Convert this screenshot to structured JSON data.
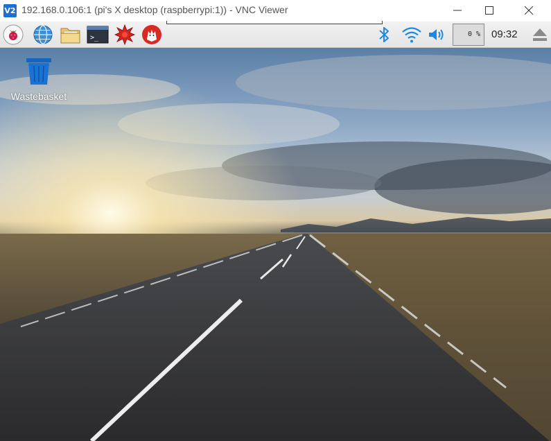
{
  "window": {
    "app_icon_text": "V2",
    "title": "192.168.0.106:1 (pi's X desktop (raspberrypi:1)) - VNC Viewer"
  },
  "panel": {
    "launchers": [
      "raspberry-menu-icon",
      "web-browser-icon",
      "file-manager-icon",
      "terminal-icon",
      "math-icon",
      "wolfram-icon"
    ],
    "tray": [
      "bluetooth-icon",
      "wifi-icon",
      "volume-icon"
    ],
    "cpu_usage": "0 %",
    "clock": "09:32",
    "eject_icon": "eject-icon"
  },
  "desktop": {
    "icons": [
      {
        "label": "Wastebasket",
        "icon": "trash-icon"
      }
    ]
  },
  "colors": {
    "accent": "#1f6fd1",
    "trash_blue": "#1a73d4",
    "tray_blue": "#1e88e5"
  }
}
